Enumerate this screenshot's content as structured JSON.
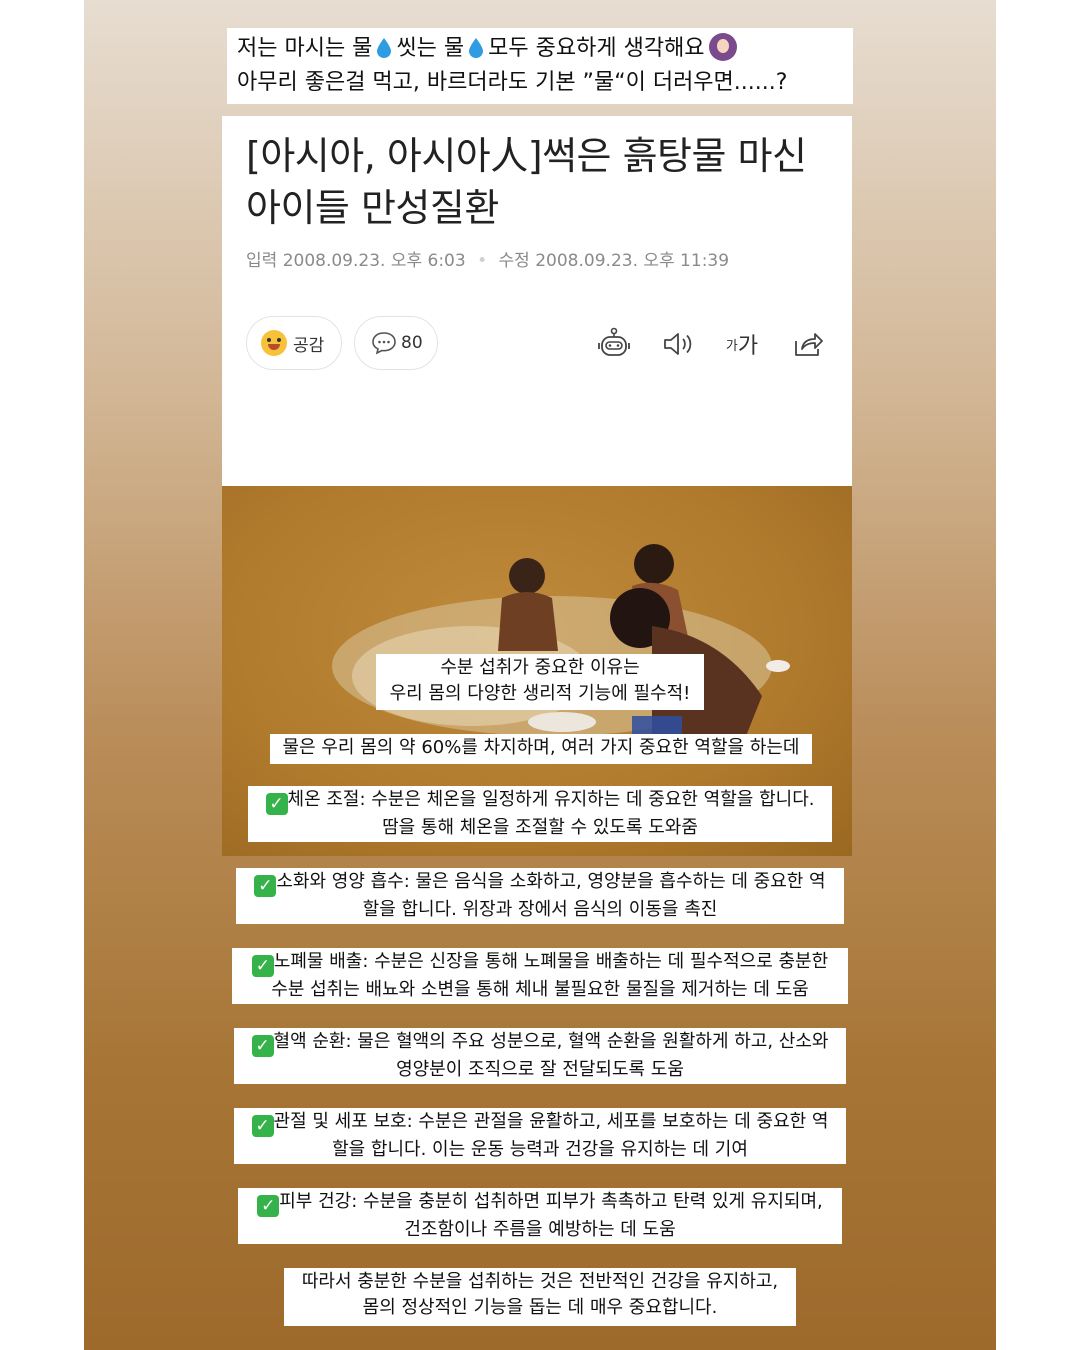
{
  "top_caption": {
    "line1_part1": "저는 마시는 물",
    "line1_part2": "씻는 물",
    "line1_part3": "모두 중요하게 생각해요",
    "line2": "아무리 좋은걸 먹고, 바르더라도 기본 ”물“이 더러우면......?"
  },
  "article": {
    "title_line1": "[아시아, 아시아人]썩은 흙탕물 마신",
    "title_line2": "아이들 만성질환",
    "input_label": "입력",
    "input_date": "2008.09.23. 오후 6:03",
    "edit_label": "수정",
    "edit_date": "2008.09.23. 오후 11:39",
    "like_label": "공감",
    "comment_count": "80",
    "fontsize_small": "가",
    "fontsize_large": "가"
  },
  "photo_captions": [
    {
      "lines": [
        "수분 섭취가 중요한 이유는",
        "우리 몸의 다양한 생리적 기능에 필수적!"
      ]
    },
    {
      "lines": [
        "물은 우리 몸의 약 60%를 차지하며, 여러 가지 중요한 역할을 하는데"
      ]
    },
    {
      "lines": [
        "체온 조절: 수분은 체온을 일정하게 유지하는 데 중요한 역할을 합니다.",
        "땀을 통해 체온을 조절할 수 있도록 도와줌"
      ]
    }
  ],
  "benefits": [
    {
      "lines": [
        "소화와 영양 흡수: 물은 음식을 소화하고, 영양분을 흡수하는 데 중요한 역",
        "할을 합니다. 위장과 장에서 음식의 이동을 촉진"
      ]
    },
    {
      "lines": [
        "노폐물 배출: 수분은 신장을 통해 노폐물을 배출하는 데 필수적으로 충분한",
        "수분 섭취는 배뇨와 소변을 통해 체내 불필요한 물질을 제거하는 데 도움"
      ]
    },
    {
      "lines": [
        "혈액 순환: 물은 혈액의 주요 성분으로, 혈액 순환을 원활하게 하고, 산소와",
        "영양분이 조직으로 잘 전달되도록 도움"
      ]
    },
    {
      "lines": [
        "관절 및 세포 보호: 수분은 관절을 윤활하고, 세포를 보호하는 데 중요한 역",
        "할을 합니다. 이는 운동 능력과 건강을 유지하는 데 기여"
      ]
    },
    {
      "lines": [
        "피부 건강: 수분을 충분히 섭취하면 피부가 촉촉하고 탄력 있게 유지되며,",
        "건조함이나 주름을 예방하는 데 도움"
      ]
    }
  ],
  "conclusion": {
    "lines": [
      "따라서 충분한 수분을 섭취하는 것은 전반적인 건강을 유지하고,",
      "몸의 정상적인 기능을 돕는 데 매우 중요합니다."
    ]
  },
  "icons": {
    "check": "✓",
    "water_drop": "water-drop-icon",
    "robot": "robot-icon",
    "speaker": "speaker-icon",
    "share": "share-icon"
  },
  "colors": {
    "check_green": "#35b34a",
    "drop_blue": "#2f9be3"
  }
}
